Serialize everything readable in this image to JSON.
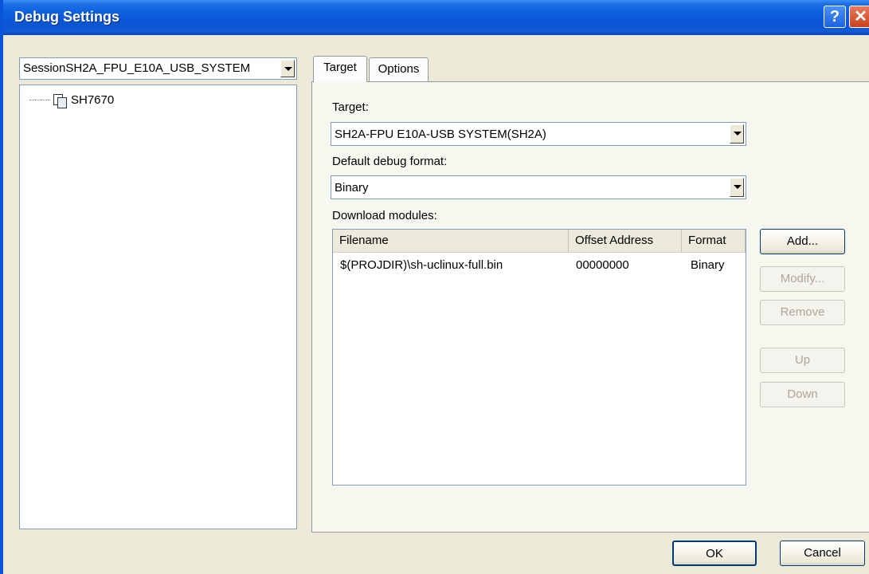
{
  "window": {
    "title": "Debug Settings",
    "help_label": "?",
    "close_label": "✕"
  },
  "session": {
    "selected": "SessionSH2A_FPU_E10A_USB_SYSTEM"
  },
  "tree": {
    "items": [
      {
        "label": "SH7670",
        "icon": "cpu-node-icon"
      }
    ]
  },
  "tabs": [
    {
      "label": "Target",
      "active": true
    },
    {
      "label": "Options",
      "active": false
    }
  ],
  "target_tab": {
    "target_label": "Target:",
    "target_value": "SH2A-FPU E10A-USB SYSTEM(SH2A)",
    "format_label": "Default debug format:",
    "format_value": "Binary",
    "modules_label": "Download modules:",
    "columns": [
      "Filename",
      "Offset Address",
      "Format"
    ],
    "rows": [
      {
        "filename": "$(PROJDIR)\\sh-uclinux-full.bin",
        "offset": "00000000",
        "format": "Binary"
      }
    ],
    "buttons": {
      "add": "Add...",
      "modify": "Modify...",
      "remove": "Remove",
      "up": "Up",
      "down": "Down"
    }
  },
  "footer": {
    "ok": "OK",
    "cancel": "Cancel"
  }
}
